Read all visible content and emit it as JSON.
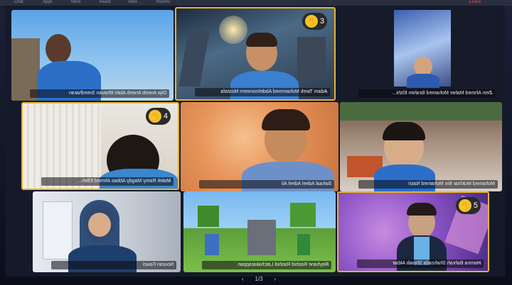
{
  "meeting": {
    "top_bar_items": [
      "Chat",
      "Apps",
      "More",
      "React",
      "View",
      "Rooms",
      "Leave"
    ],
    "pager": {
      "prev": "‹",
      "label": "1/3",
      "next": "›"
    }
  },
  "participants": [
    {
      "name": "Dija Aneeb Aneeb Alahi Bhavan Sreedharan",
      "hand": null,
      "active": false
    },
    {
      "name": "Adam Tarek Mohammed Abdelmoneem Mostafa",
      "hand": "3",
      "active": true
    },
    {
      "name": "Zein Ahmed Maher Mohamed Ibrahim Elshi...",
      "hand": null,
      "active": false
    },
    {
      "name": "Malek Ramy Magdy Abbas Ahmed Elfeh...",
      "hand": "4",
      "active": true
    },
    {
      "name": "Sahaal Adeel Adeel Ali",
      "hand": null,
      "active": false
    },
    {
      "name": "Mohamed Mukhtar Bin Mohamed Nasri",
      "hand": null,
      "active": false
    },
    {
      "name": "Nouran Fawzi",
      "hand": null,
      "active": false
    },
    {
      "name": "Rayhane Rashid Rashid Latchakarappan",
      "hand": null,
      "active": false
    },
    {
      "name": "Hamna Bahrah Shahzada Shoaib Akbar",
      "hand": "5",
      "active": true
    }
  ],
  "colors": {
    "hand_raise_border": "#e5b32d",
    "hand_icon": "#f2c12e"
  }
}
